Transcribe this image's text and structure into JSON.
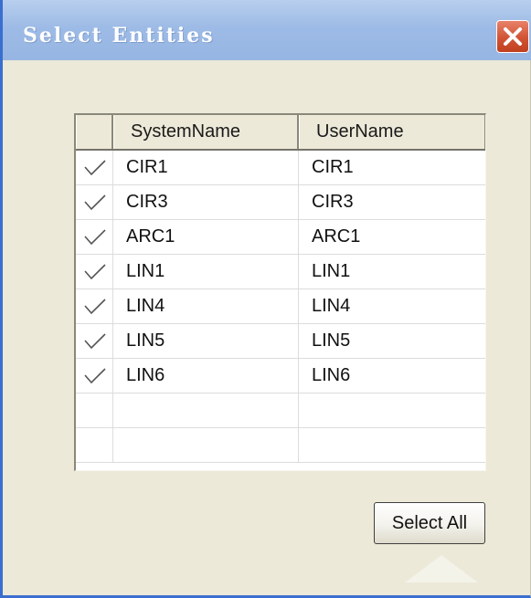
{
  "dialog": {
    "title": "Select Entities",
    "close_symbol": "close-icon"
  },
  "table": {
    "columns": [
      "",
      "SystemName",
      "UserName"
    ],
    "rows": [
      {
        "checked": true,
        "system_name": "CIR1",
        "user_name": "CIR1"
      },
      {
        "checked": true,
        "system_name": "CIR3",
        "user_name": "CIR3"
      },
      {
        "checked": true,
        "system_name": "ARC1",
        "user_name": "ARC1"
      },
      {
        "checked": true,
        "system_name": "LIN1",
        "user_name": "LIN1"
      },
      {
        "checked": true,
        "system_name": "LIN4",
        "user_name": "LIN4"
      },
      {
        "checked": true,
        "system_name": "LIN5",
        "user_name": "LIN5"
      },
      {
        "checked": true,
        "system_name": "LIN6",
        "user_name": "LIN6"
      }
    ]
  },
  "buttons": {
    "select_all": "Select All"
  },
  "colors": {
    "titlebar": "#9dbbe6",
    "dialog_bg": "#ece9d8",
    "close_button": "#d25335"
  }
}
